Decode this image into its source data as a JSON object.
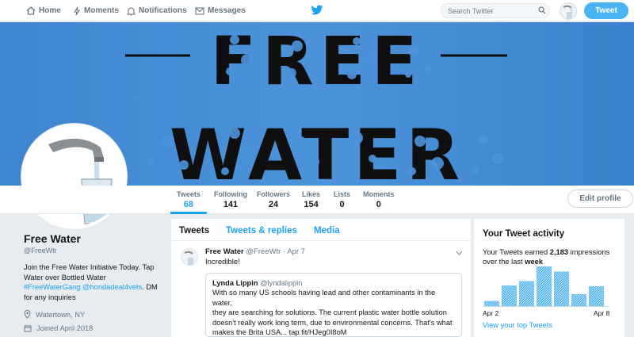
{
  "nav": {
    "home": "Home",
    "moments": "Moments",
    "notifications": "Notifications",
    "messages": "Messages",
    "search_placeholder": "Search Twitter",
    "tweet_button": "Tweet"
  },
  "banner": {
    "line1": "FREE",
    "line2": "WATER"
  },
  "stats": [
    {
      "label": "Tweets",
      "value": "68"
    },
    {
      "label": "Following",
      "value": "141"
    },
    {
      "label": "Followers",
      "value": "24"
    },
    {
      "label": "Likes",
      "value": "154"
    },
    {
      "label": "Lists",
      "value": "0"
    },
    {
      "label": "Moments",
      "value": "0"
    }
  ],
  "edit_profile": "Edit profile",
  "profile": {
    "name": "Free Water",
    "handle": "@FreeWtr",
    "bio_line1": "Join the Free Water Initiative Today. Tap",
    "bio_line2": "Water over Bottled Water",
    "bio_tag1": "#FreeWaterGang",
    "bio_tag2": "@hondadeal4vets",
    "bio_tail": ". DM",
    "bio_line4": "for any inquiries",
    "location": "Watertown, NY",
    "joined": "Joined April 2018"
  },
  "tabs": {
    "tweets": "Tweets",
    "replies": "Tweets & replies",
    "media": "Media"
  },
  "tweet": {
    "name": "Free Water",
    "handle_date": "@FreeWtr · Apr 7",
    "text": "Incredible!",
    "quote_name": "Lynda Lippin",
    "quote_handle": "@lyndalippin",
    "quote_line1": "With so many US schools having lead and other contaminants in the water,",
    "quote_line2": "they are searching for solutions. The current plastic water bottle solution",
    "quote_line3": "doesn't really work long term, due to environmental concerns. That's what",
    "quote_line4": "makes the Brita USA... tap.fit/HJeg0I8oM"
  },
  "activity": {
    "title": "Your Tweet activity",
    "line1_pre": "Your Tweets earned",
    "line1_num": "2,183",
    "line1_post": "impressions",
    "line2_pre": "over the last",
    "line2_bold": "week",
    "start_label": "Apr 2",
    "end_label": "Apr 8",
    "link": "View your top Tweets",
    "bars": [
      0.13,
      0.52,
      0.63,
      1.0,
      0.87,
      0.3,
      0.5
    ],
    "bar_color": "#1da1f2"
  },
  "colors": {
    "accent": "#1da1f2",
    "banner": "#4c93db",
    "background": "#e6ecf0"
  }
}
